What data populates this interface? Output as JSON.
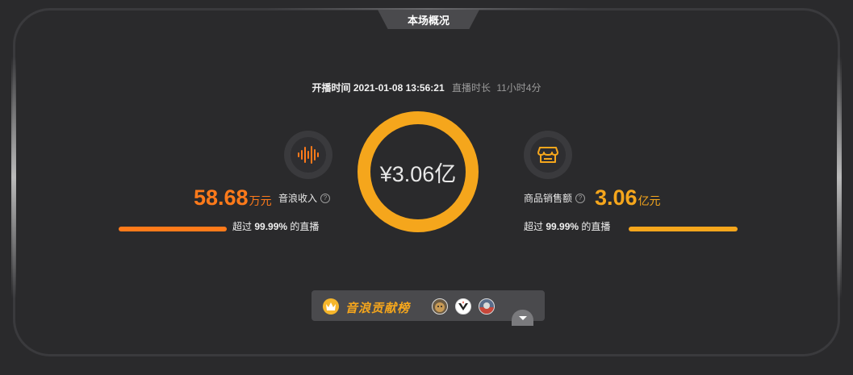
{
  "header": {
    "title": "本场概况"
  },
  "meta": {
    "start_label": "开播时间",
    "start_time": "2021-01-08 13:56:21",
    "duration_label": "直播时长",
    "duration_value": "11小时4分"
  },
  "center": {
    "total": "¥3.06亿"
  },
  "left_stat": {
    "value": "58.68",
    "unit": "万元",
    "label": "音浪收入",
    "exceed_prefix": "超过",
    "exceed_pct": "99.99%",
    "exceed_suffix": "的直播",
    "bar_fraction": 0.9999,
    "color": "#ff7a1a",
    "icon": "sound-wave-icon"
  },
  "right_stat": {
    "value": "3.06",
    "unit": "亿元",
    "label": "商品销售额",
    "exceed_prefix": "超过",
    "exceed_pct": "99.99%",
    "exceed_suffix": "的直播",
    "bar_fraction": 0.9999,
    "color": "#f5a61c",
    "icon": "store-icon"
  },
  "contribution": {
    "title": "音浪贡献榜",
    "icon": "crown-icon",
    "avatars": [
      "avatar-1",
      "avatar-2",
      "avatar-3"
    ]
  },
  "colors": {
    "accent_orange": "#ff7a1a",
    "accent_yellow": "#f5a61c",
    "background": "#2a2a2c"
  }
}
